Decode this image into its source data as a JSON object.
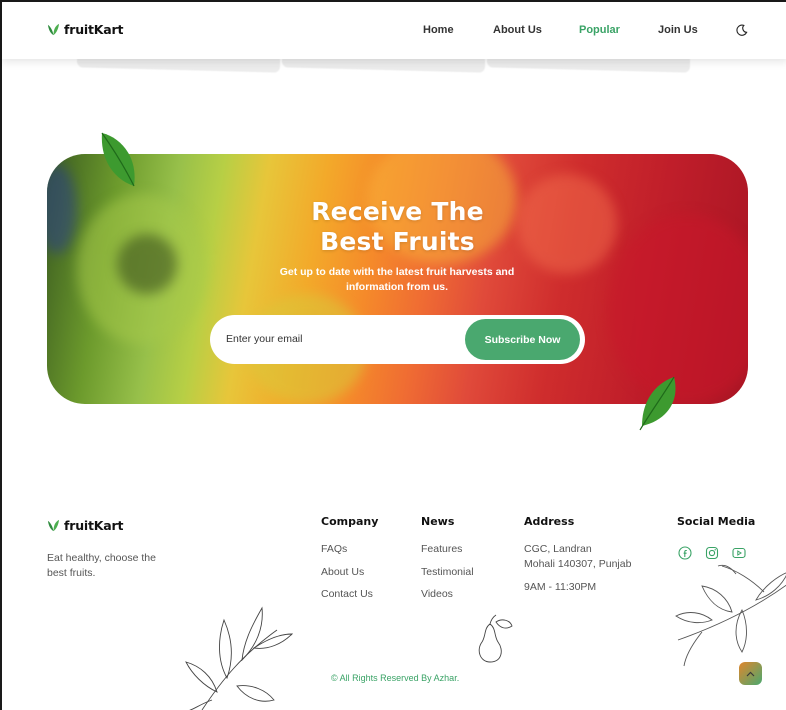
{
  "header": {
    "brand": "fruitKart",
    "nav": [
      {
        "label": "Home",
        "active": false
      },
      {
        "label": "About Us",
        "active": false
      },
      {
        "label": "Popular",
        "active": true
      },
      {
        "label": "Join Us",
        "active": false
      }
    ],
    "theme_toggle_icon": "moon-icon"
  },
  "banner": {
    "title_line1": "Receive The",
    "title_line2": "Best Fruits",
    "subtitle": "Get up to date with the latest fruit harvests and information from us.",
    "email_placeholder": "Enter your email",
    "button_label": "Subscribe Now"
  },
  "footer": {
    "brand": "fruitKart",
    "tagline": "Eat healthy, choose the best fruits.",
    "company": {
      "title": "Company",
      "links": [
        "FAQs",
        "About Us",
        "Contact Us"
      ]
    },
    "news": {
      "title": "News",
      "links": [
        "Features",
        "Testimonial",
        "Videos"
      ]
    },
    "address": {
      "title": "Address",
      "line1": "CGC, Landran",
      "line2": "Mohali 140307, Punjab",
      "hours": "9AM - 11:30PM"
    },
    "social": {
      "title": "Social Media",
      "icons": [
        "facebook-icon",
        "instagram-icon",
        "youtube-icon"
      ]
    },
    "copyright": "© All Rights Reserved By Azhar."
  },
  "colors": {
    "accent": "#4aa86f",
    "active_nav": "#3aa366",
    "text_dark": "#111111"
  }
}
